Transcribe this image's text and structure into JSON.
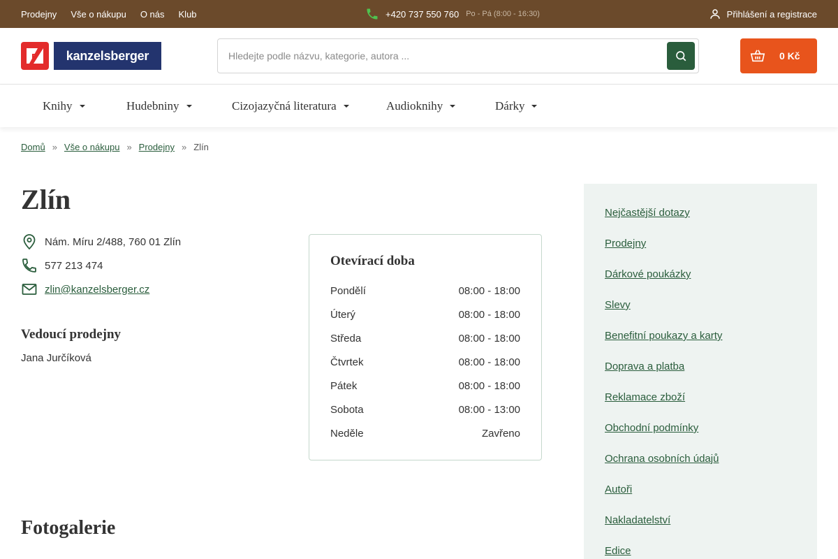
{
  "topbar": {
    "nav": [
      "Prodejny",
      "Vše o nákupu",
      "O nás",
      "Klub"
    ],
    "phone": "+420 737 550 760",
    "phone_hours": "Po - Pá (8:00 - 16:30)",
    "login": "Přihlášení a registrace"
  },
  "header": {
    "logo_text": "kanzelsberger",
    "search_placeholder": "Hledejte podle názvu, kategorie, autora ...",
    "cart_total": "0 Kč"
  },
  "categories": [
    "Knihy",
    "Hudebniny",
    "Cizojazyčná literatura",
    "Audioknihy",
    "Dárky"
  ],
  "breadcrumb": {
    "items": [
      "Domů",
      "Vše o nákupu",
      "Prodejny"
    ],
    "current": "Zlín",
    "separator": "»"
  },
  "store": {
    "title": "Zlín",
    "address": "Nám. Míru 2/488, 760 01 Zlín",
    "phone": "577 213 474",
    "email": "zlin@kanzelsberger.cz",
    "manager_heading": "Vedoucí prodejny",
    "manager_name": "Jana Jurčíková"
  },
  "opening_hours": {
    "heading": "Otevírací doba",
    "rows": [
      {
        "day": "Pondělí",
        "time": "08:00 - 18:00"
      },
      {
        "day": "Úterý",
        "time": "08:00 - 18:00"
      },
      {
        "day": "Středa",
        "time": "08:00 - 18:00"
      },
      {
        "day": "Čtvrtek",
        "time": "08:00 - 18:00"
      },
      {
        "day": "Pátek",
        "time": "08:00 - 18:00"
      },
      {
        "day": "Sobota",
        "time": "08:00 - 13:00"
      },
      {
        "day": "Neděle",
        "time": "Zavřeno"
      }
    ]
  },
  "gallery_heading": "Fotogalerie",
  "sidebar_links": [
    "Nejčastější dotazy",
    "Prodejny",
    "Dárkové poukázky",
    "Slevy",
    "Benefitní poukazy a karty",
    "Doprava a platba",
    "Reklamace zboží",
    "Obchodní podmínky",
    "Ochrana osobních údajů",
    "Autoři",
    "Nakladatelství",
    "Edice"
  ],
  "colors": {
    "topbar": "#6b4a2b",
    "accent_green": "#2a5d3c",
    "cart_orange": "#e8541c",
    "logo_red": "#e32b2b",
    "logo_navy": "#23346e",
    "sidebar_bg": "#eef3f1"
  }
}
